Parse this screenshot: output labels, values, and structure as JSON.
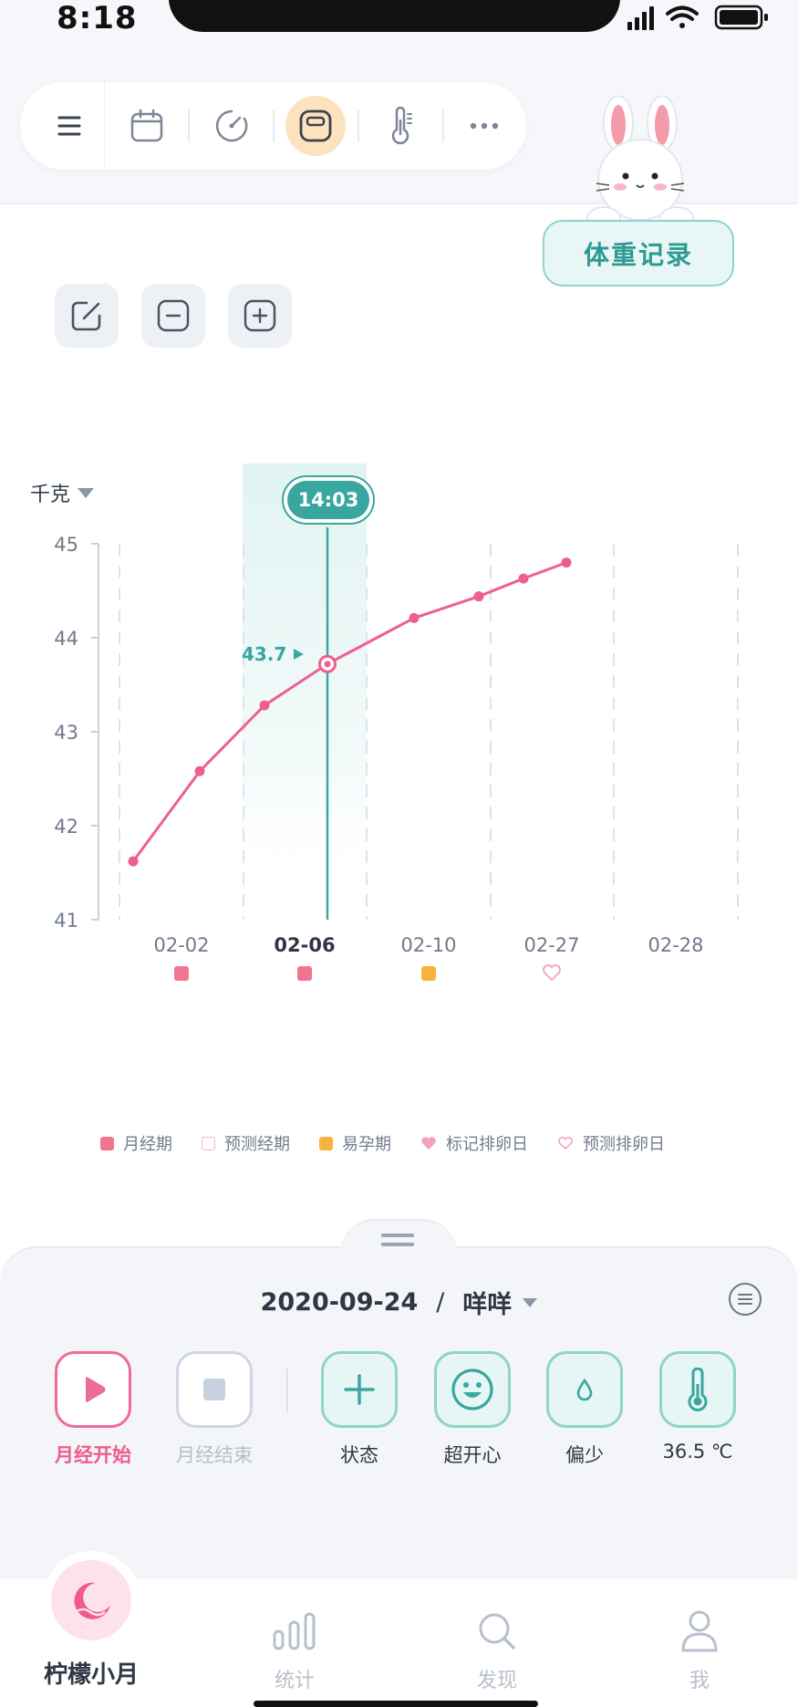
{
  "status_bar": {
    "time": "8:18"
  },
  "toolbar": {
    "items": [
      {
        "icon": "menu-icon"
      },
      {
        "icon": "calendar-icon"
      },
      {
        "icon": "gauge-icon"
      },
      {
        "icon": "scale-icon",
        "active": true
      },
      {
        "icon": "thermometer-icon"
      },
      {
        "icon": "more-icon"
      }
    ]
  },
  "weight_record_label": "体重记录",
  "chart_tools": [
    {
      "icon": "edit-icon"
    },
    {
      "icon": "zoom-out-icon"
    },
    {
      "icon": "zoom-in-icon"
    }
  ],
  "chart": {
    "unit_label": "千克",
    "tooltip_time": "14:03",
    "selected_value_label": "43.7"
  },
  "chart_data": {
    "type": "line",
    "ylim": [
      41,
      45
    ],
    "yticks": [
      "45",
      "44",
      "43",
      "42",
      "41"
    ],
    "x_labels": [
      {
        "label": "02-02",
        "marker": "period",
        "bold": false
      },
      {
        "label": "02-06",
        "marker": "period",
        "bold": true
      },
      {
        "label": "02-10",
        "marker": "fertile",
        "bold": false
      },
      {
        "label": "02-27",
        "marker": "predicted-ovulation",
        "bold": false
      },
      {
        "label": "02-28",
        "marker": null,
        "bold": false
      }
    ],
    "points": [
      41.62,
      42.58,
      43.28,
      43.72,
      44.21,
      44.44,
      44.63,
      44.8
    ],
    "selected_index": 3,
    "colors": {
      "line": "#ee5f8f",
      "cursor": "#3aa6a0",
      "period": "#f0768f",
      "fertile": "#f7b33f",
      "ovulation": "#f3a3bc"
    }
  },
  "legend": [
    {
      "label": "月经期",
      "kind": "period"
    },
    {
      "label": "预测经期",
      "kind": "predicted-period"
    },
    {
      "label": "易孕期",
      "kind": "fertile"
    },
    {
      "label": "标记排卵日",
      "kind": "ovulation"
    },
    {
      "label": "预测排卵日",
      "kind": "predicted-ovulation"
    }
  ],
  "sheet": {
    "date": "2020-09-24",
    "separator": "/",
    "mood_name": "咩咩",
    "actions": [
      {
        "label": "月经开始",
        "icon": "play-icon"
      },
      {
        "label": "月经结束",
        "icon": "stop-icon"
      },
      {
        "label": "状态",
        "icon": "plus-icon"
      },
      {
        "label": "超开心",
        "icon": "smile-icon"
      },
      {
        "label": "偏少",
        "icon": "drop-icon"
      },
      {
        "label": "36.5 ℃",
        "icon": "thermometer-icon"
      }
    ]
  },
  "tabbar": {
    "home_label": "柠檬小月",
    "tabs": [
      {
        "label": "统计",
        "icon": "stats-icon"
      },
      {
        "label": "发现",
        "icon": "search-icon"
      },
      {
        "label": "我",
        "icon": "profile-icon"
      }
    ]
  }
}
